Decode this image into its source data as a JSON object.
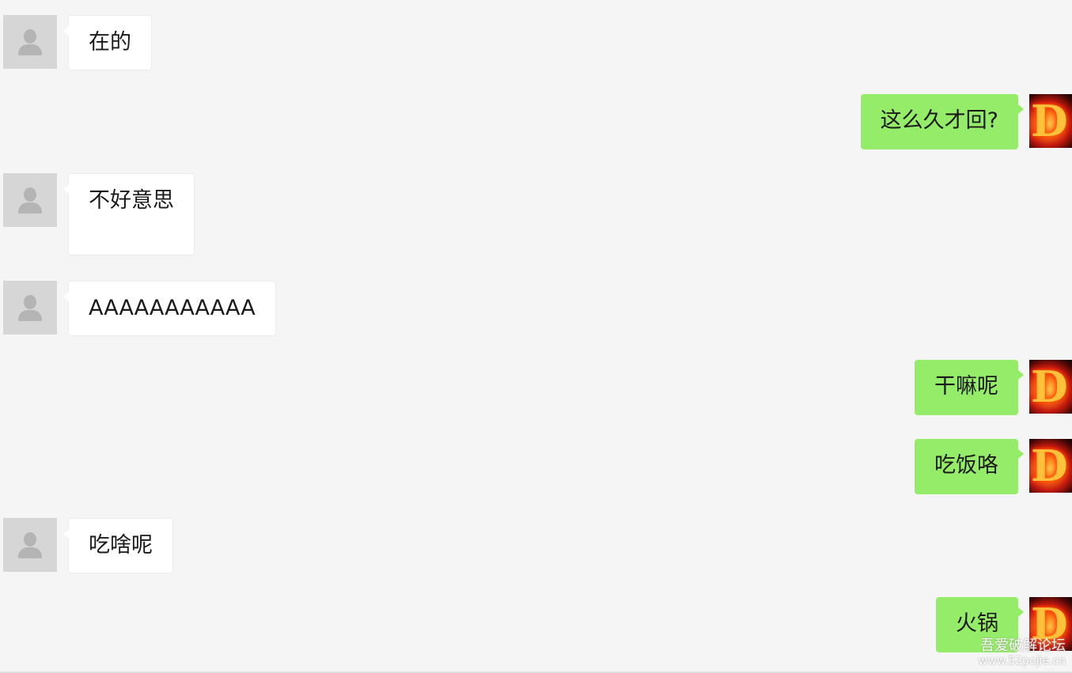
{
  "messages": [
    {
      "side": "left",
      "text": "在的",
      "avatar": "default-user-avatar"
    },
    {
      "side": "right",
      "text": "这么久才回?",
      "avatar": "fire-d-avatar"
    },
    {
      "side": "left",
      "text": "不好意思",
      "avatar": "default-user-avatar"
    },
    {
      "side": "left",
      "text": "AAAAAAAAAAA",
      "avatar": "default-user-avatar"
    },
    {
      "side": "right",
      "text": "干嘛呢",
      "avatar": "fire-d-avatar"
    },
    {
      "side": "right",
      "text": "吃饭咯",
      "avatar": "fire-d-avatar"
    },
    {
      "side": "left",
      "text": "吃啥呢",
      "avatar": "default-user-avatar"
    },
    {
      "side": "right",
      "text": "火锅",
      "avatar": "fire-d-avatar"
    }
  ],
  "avatar_glyph": "D",
  "watermark": {
    "title": "吾爱破解论坛",
    "url": "www.52pojie.cn"
  },
  "colors": {
    "background": "#f5f5f5",
    "incoming_bubble": "#ffffff",
    "outgoing_bubble": "#95ec69"
  }
}
